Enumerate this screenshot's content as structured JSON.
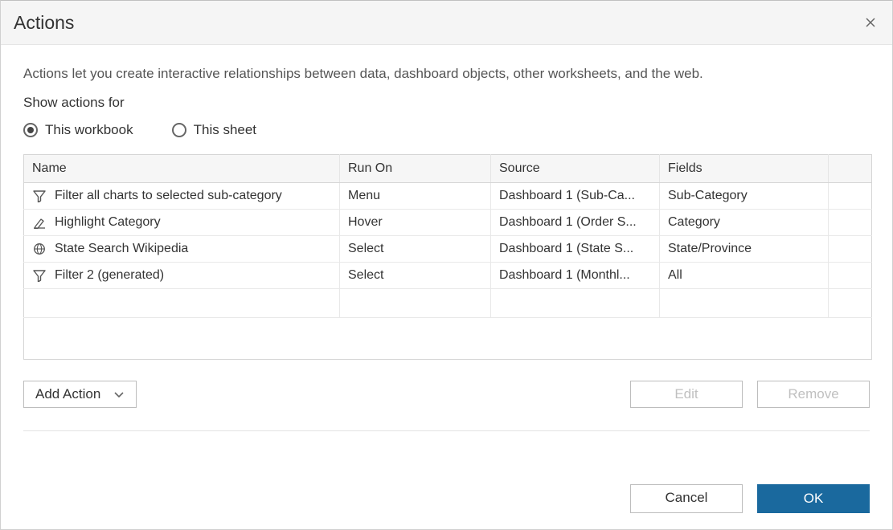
{
  "dialog": {
    "title": "Actions",
    "description": "Actions let you create interactive relationships between data, dashboard objects, other worksheets, and the web.",
    "show_actions_label": "Show actions for",
    "radios": {
      "workbook": "This workbook",
      "sheet": "This sheet",
      "selected": "workbook"
    },
    "columns": {
      "name": "Name",
      "run_on": "Run On",
      "source": "Source",
      "fields": "Fields"
    },
    "rows": [
      {
        "icon": "filter-icon",
        "name": "Filter all charts to selected sub-category",
        "run_on": "Menu",
        "source": "Dashboard 1 (Sub-Ca...",
        "fields": "Sub-Category"
      },
      {
        "icon": "highlight-icon",
        "name": "Highlight Category",
        "run_on": "Hover",
        "source": "Dashboard 1 (Order S...",
        "fields": "Category"
      },
      {
        "icon": "globe-icon",
        "name": "State Search Wikipedia",
        "run_on": "Select",
        "source": "Dashboard 1 (State S...",
        "fields": "State/Province"
      },
      {
        "icon": "filter-icon",
        "name": "Filter 2 (generated)",
        "run_on": "Select",
        "source": "Dashboard 1 (Monthl...",
        "fields": "All"
      }
    ],
    "buttons": {
      "add_action": "Add Action",
      "edit": "Edit",
      "remove": "Remove",
      "cancel": "Cancel",
      "ok": "OK"
    }
  }
}
